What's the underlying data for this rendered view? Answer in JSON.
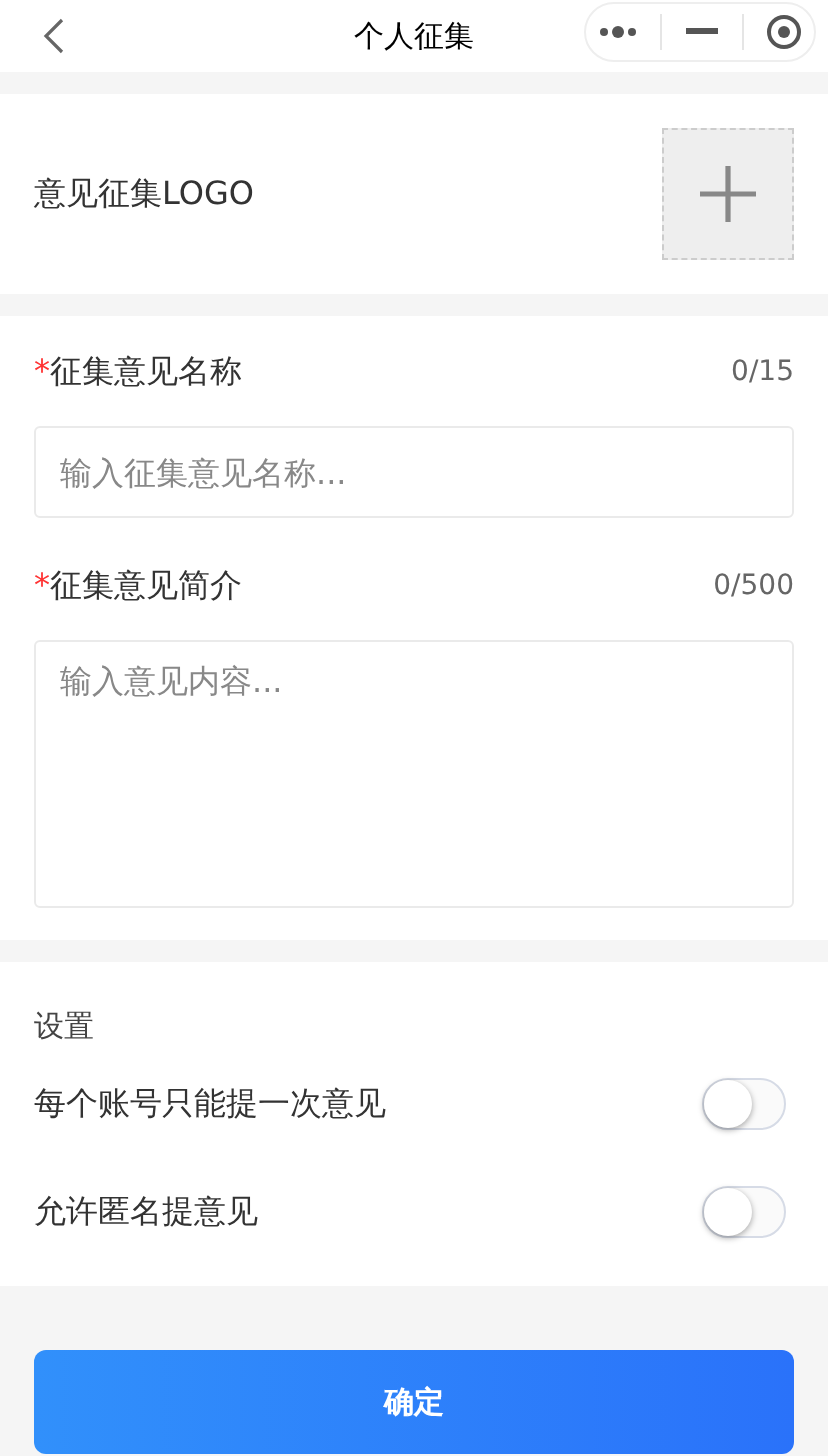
{
  "header": {
    "title": "个人征集"
  },
  "logo": {
    "label": "意见征集LOGO"
  },
  "fields": [
    {
      "kind": "input",
      "required_mark": "*",
      "label": "征集意见名称",
      "counter": "0/15",
      "placeholder": "输入征集意见名称..."
    },
    {
      "kind": "textarea",
      "required_mark": "*",
      "label": "征集意见简介",
      "counter": "0/500",
      "placeholder": "输入意见内容..."
    }
  ],
  "settings": {
    "title": "设置",
    "items": [
      {
        "label": "每个账号只能提一次意见",
        "on": false
      },
      {
        "label": "允许匿名提意见",
        "on": false
      }
    ]
  },
  "submit": {
    "label": "确定"
  }
}
